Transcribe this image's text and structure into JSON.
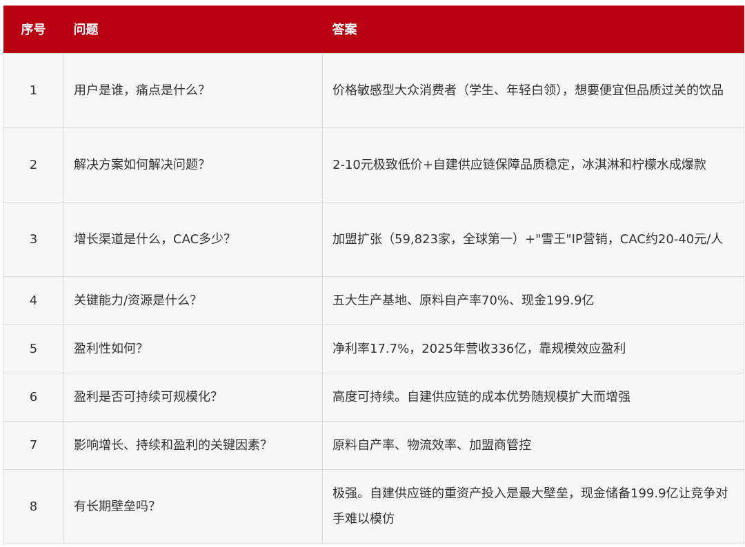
{
  "header": {
    "num": "序号",
    "question": "问题",
    "answer": "答案"
  },
  "rows": [
    {
      "num": "1",
      "question": "用户是谁，痛点是什么？",
      "answer": "价格敏感型大众消费者（学生、年轻白领），想要便宜但品质过关的饮品"
    },
    {
      "num": "2",
      "question": "解决方案如何解决问题？",
      "answer": "2-10元极致低价+自建供应链保障品质稳定，冰淇淋和柠檬水成爆款"
    },
    {
      "num": "3",
      "question": "增长渠道是什么，CAC多少？",
      "answer": "加盟扩张（59,823家，全球第一）+\"雪王\"IP营销，CAC约20-40元/人"
    },
    {
      "num": "4",
      "question": "关键能力/资源是什么？",
      "answer": "五大生产基地、原料自产率70%、现金199.9亿"
    },
    {
      "num": "5",
      "question": "盈利性如何？",
      "answer": "净利率17.7%，2025年营收336亿，靠规模效应盈利"
    },
    {
      "num": "6",
      "question": "盈利是否可持续可规模化？",
      "answer": "高度可持续。自建供应链的成本优势随规模扩大而增强"
    },
    {
      "num": "7",
      "question": "影响增长、持续和盈利的关键因素？",
      "answer": "原料自产率、物流效率、加盟商管控"
    },
    {
      "num": "8",
      "question": "有长期壁垒吗？",
      "answer": "极强。自建供应链的重资产投入是最大壁垒，现金储备199.9亿让竞争对手难以模仿"
    }
  ],
  "colors": {
    "header_bg": "#b80012",
    "header_text": "#ffffff",
    "row_bg": "#f7f7f7",
    "border": "#dcdcdc",
    "text": "#333333"
  }
}
